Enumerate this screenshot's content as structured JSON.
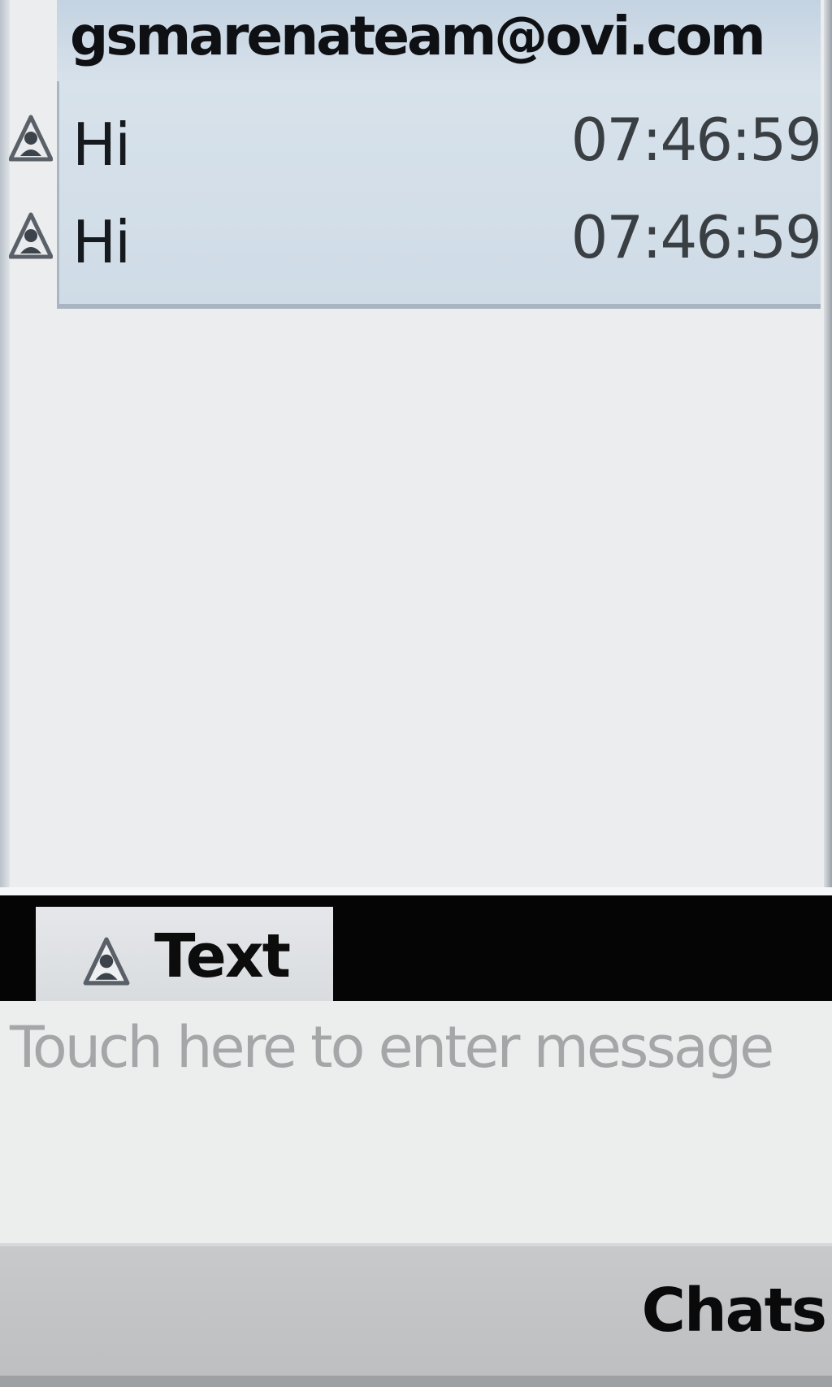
{
  "chat": {
    "contact": "gsmarenateam@ovi.com",
    "messages": [
      {
        "text": "Hi",
        "time": "07:46:59",
        "icon": "contact-status-icon"
      },
      {
        "text": "Hi",
        "time": "07:46:59",
        "icon": "contact-status-icon"
      }
    ]
  },
  "composer": {
    "tab_label": "Text",
    "tab_icon": "contact-status-icon",
    "placeholder": "Touch here to enter message"
  },
  "softkeys": {
    "right": "Chats"
  },
  "colors": {
    "message_background": "#cfdbe6",
    "tab_bar": "#050505",
    "softkey_bar": "#c1c3c5"
  }
}
